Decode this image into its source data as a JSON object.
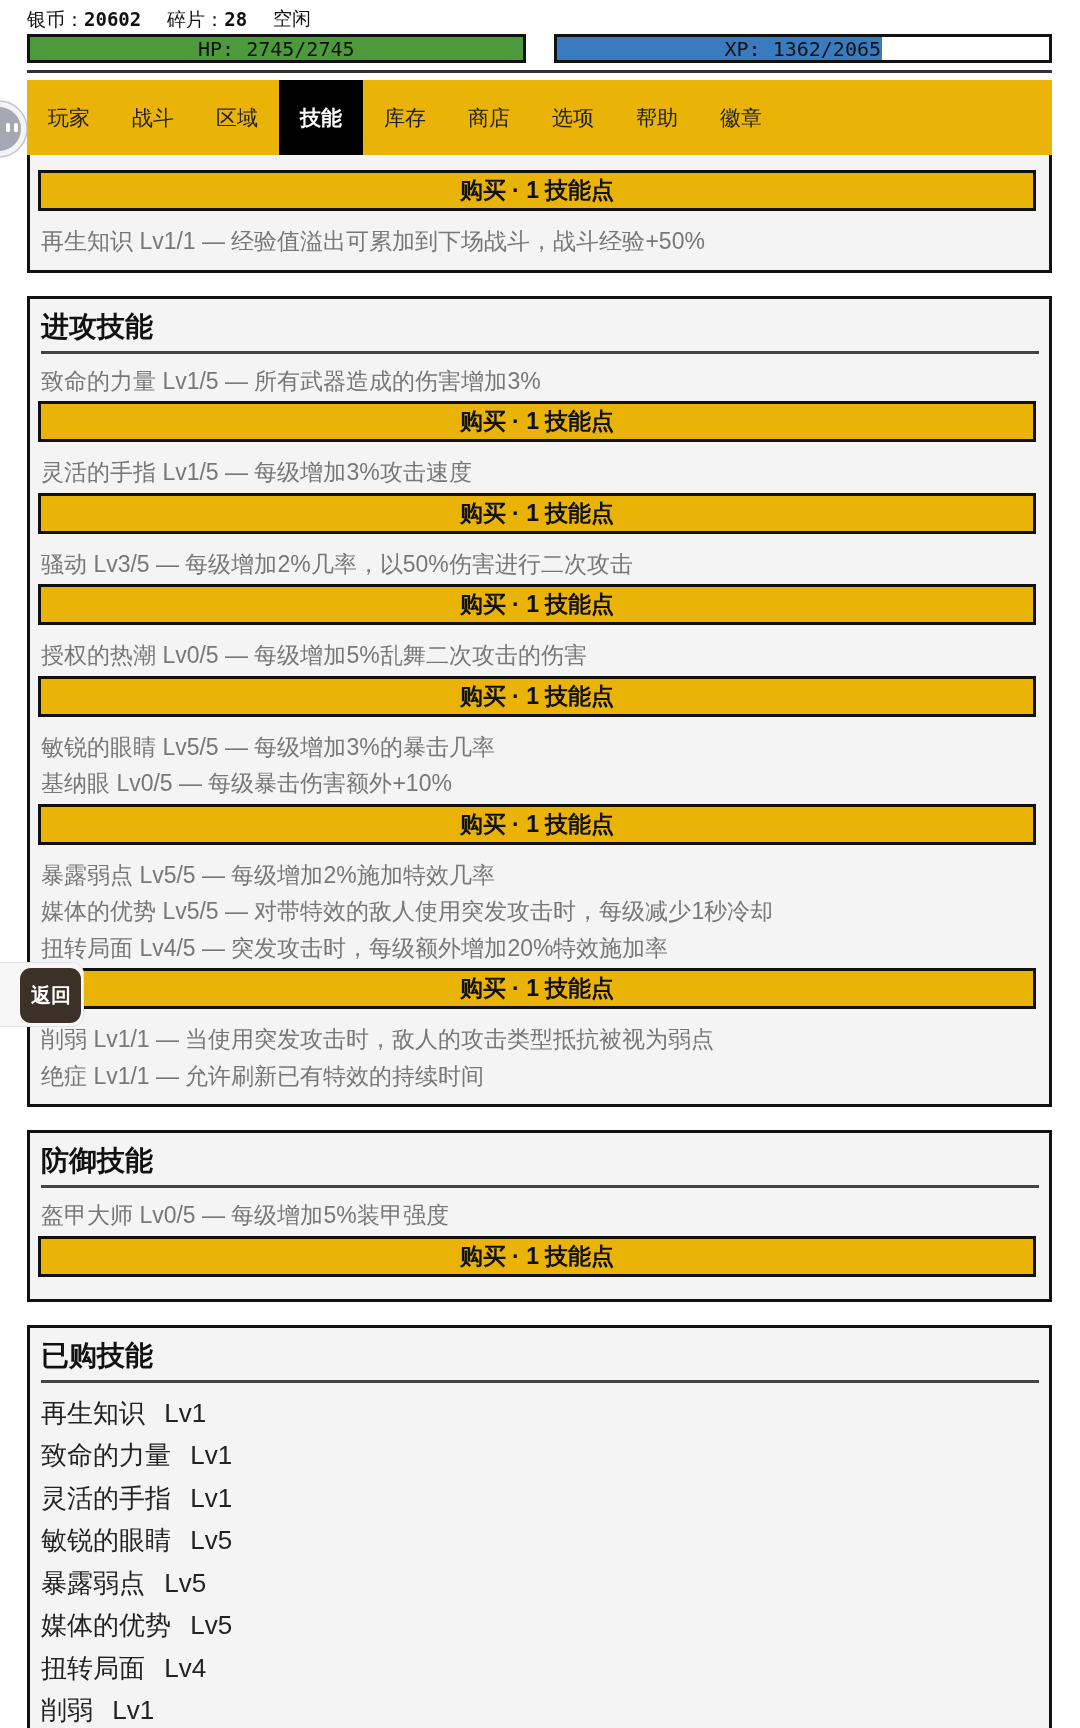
{
  "status": {
    "stats": [
      {
        "label": "银币：",
        "value": "20602"
      },
      {
        "label": "碎片：",
        "value": "28"
      }
    ],
    "state": "空闲"
  },
  "meters": [
    {
      "reading": "HP: 2745/2745",
      "level": 1,
      "color": "#4c9a3c"
    },
    {
      "reading": "XP: 1362/2065",
      "level": 0.66,
      "color": "#3a7bbf"
    }
  ],
  "tabs": [
    {
      "label": "玩家",
      "selected": false
    },
    {
      "label": "战斗",
      "selected": false
    },
    {
      "label": "区域",
      "selected": false
    },
    {
      "label": "技能",
      "selected": true
    },
    {
      "label": "库存",
      "selected": false
    },
    {
      "label": "商店",
      "selected": false
    },
    {
      "label": "选项",
      "selected": false
    },
    {
      "label": "帮助",
      "selected": false
    },
    {
      "label": "徽章",
      "selected": false
    }
  ],
  "sections": [
    {
      "items": [
        {
          "kind": "buy",
          "label": "购买 · 1 技能点"
        },
        {
          "kind": "skill",
          "text": "再生知识 Lv1/1 — 经验值溢出可累加到下场战斗，战斗经验+50%"
        }
      ]
    },
    {
      "title": "进攻技能",
      "items": [
        {
          "kind": "skill",
          "text": "致命的力量 Lv1/5 — 所有武器造成的伤害增加3%"
        },
        {
          "kind": "buy",
          "label": "购买 · 1 技能点"
        },
        {
          "kind": "skill",
          "text": "灵活的手指 Lv1/5 — 每级增加3%攻击速度"
        },
        {
          "kind": "buy",
          "label": "购买 · 1 技能点"
        },
        {
          "kind": "skill",
          "text": "骚动 Lv3/5 — 每级增加2%几率，以50%伤害进行二次攻击"
        },
        {
          "kind": "buy",
          "label": "购买 · 1 技能点"
        },
        {
          "kind": "skill",
          "text": "授权的热潮 Lv0/5 — 每级增加5%乱舞二次攻击的伤害"
        },
        {
          "kind": "buy",
          "label": "购买 · 1 技能点"
        },
        {
          "kind": "skill",
          "text": "敏锐的眼睛 Lv5/5 — 每级增加3%的暴击几率"
        },
        {
          "kind": "skill",
          "text": "基纳眼 Lv0/5 — 每级暴击伤害额外+10%"
        },
        {
          "kind": "buy",
          "label": "购买 · 1 技能点"
        },
        {
          "kind": "skill",
          "text": "暴露弱点 Lv5/5 — 每级增加2%施加特效几率"
        },
        {
          "kind": "skill",
          "text": "媒体的优势 Lv5/5 — 对带特效的敌人使用突发攻击时，每级减少1秒冷却"
        },
        {
          "kind": "skill",
          "text": "扭转局面 Lv4/5 — 突发攻击时，每级额外增加20%特效施加率"
        },
        {
          "kind": "buy",
          "label": "购买 · 1 技能点"
        },
        {
          "kind": "skill",
          "text": "削弱 Lv1/1 — 当使用突发攻击时，敌人的攻击类型抵抗被视为弱点"
        },
        {
          "kind": "skill",
          "text": "绝症 Lv1/1 — 允许刷新已有特效的持续时间"
        }
      ]
    },
    {
      "title": "防御技能",
      "items": [
        {
          "kind": "skill",
          "text": "盔甲大师 Lv0/5 — 每级增加5%装甲强度"
        },
        {
          "kind": "buy",
          "label": "购买 · 1 技能点"
        }
      ]
    },
    {
      "title": "已购技能",
      "items": [
        {
          "kind": "owned",
          "name": "再生知识",
          "rank": "Lv1"
        },
        {
          "kind": "owned",
          "name": "致命的力量",
          "rank": "Lv1"
        },
        {
          "kind": "owned",
          "name": "灵活的手指",
          "rank": "Lv1"
        },
        {
          "kind": "owned",
          "name": "敏锐的眼睛",
          "rank": "Lv5"
        },
        {
          "kind": "owned",
          "name": "暴露弱点",
          "rank": "Lv5"
        },
        {
          "kind": "owned",
          "name": "媒体的优势",
          "rank": "Lv5"
        },
        {
          "kind": "owned",
          "name": "扭转局面",
          "rank": "Lv4"
        },
        {
          "kind": "owned",
          "name": "削弱",
          "rank": "Lv1"
        }
      ]
    }
  ],
  "back_button": {
    "label": "返回"
  }
}
